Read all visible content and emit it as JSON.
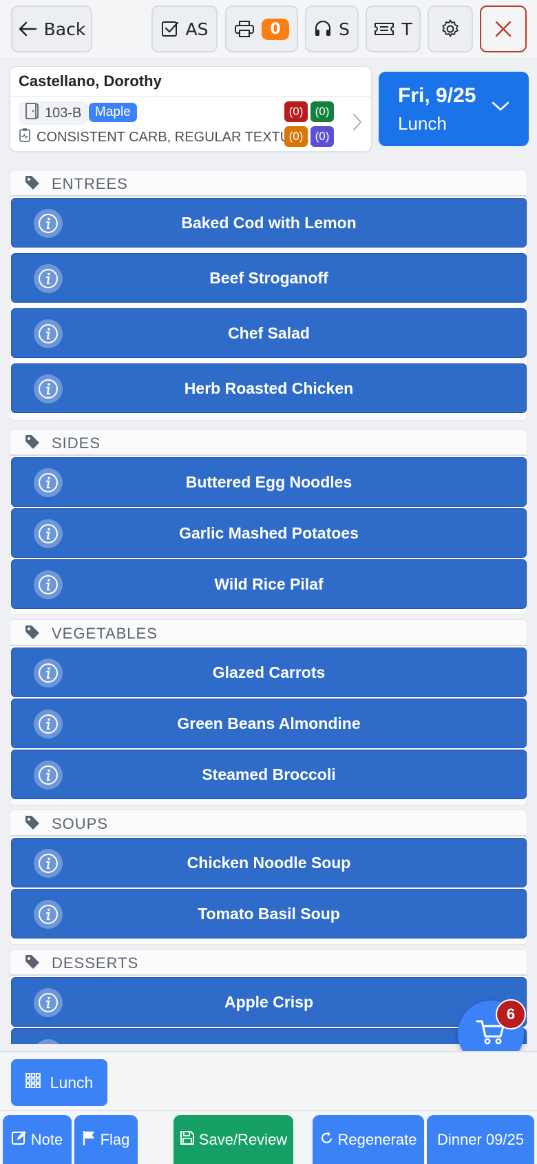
{
  "header": {
    "back_label": "Back",
    "as_label": "AS",
    "print_count": "0",
    "support_label": "S",
    "ticket_label": "T"
  },
  "patient": {
    "name": "Castellano, Dorothy",
    "room": "103-B",
    "unit": "Maple",
    "diet": "CONSISTENT CARB, REGULAR TEXTURE",
    "counts": [
      "(0)",
      "(0)",
      "(0)",
      "(0)"
    ]
  },
  "meal_selector": {
    "date": "Fri, 9/25",
    "meal": "Lunch"
  },
  "categories": [
    {
      "label": "ENTREES",
      "items": [
        "Baked Cod with Lemon",
        "Beef Stroganoff",
        "Chef Salad",
        "Herb Roasted Chicken"
      ]
    },
    {
      "label": "SIDES",
      "items": [
        "Buttered Egg Noodles",
        "Garlic Mashed Potatoes",
        "Wild Rice Pilaf"
      ]
    },
    {
      "label": "VEGETABLES",
      "items": [
        "Glazed Carrots",
        "Green Beans Almondine",
        "Steamed Broccoli"
      ]
    },
    {
      "label": "SOUPS",
      "items": [
        "Chicken Noodle Soup",
        "Tomato Basil Soup"
      ]
    },
    {
      "label": "DESSERTS",
      "items": [
        "Apple Crisp"
      ]
    }
  ],
  "cart": {
    "count": "6"
  },
  "footer": {
    "meal_button": "Lunch",
    "note": "Note",
    "flag": "Flag",
    "save_review": "Save/Review",
    "regenerate": "Regenerate",
    "next_meal": "Dinner 09/25"
  },
  "colors": {
    "primary": "#3b82f6",
    "item_bg": "#2f6bc9",
    "save_green": "#16a066",
    "badge_orange": "#fd7e14",
    "badge_red": "#b91c1c"
  }
}
